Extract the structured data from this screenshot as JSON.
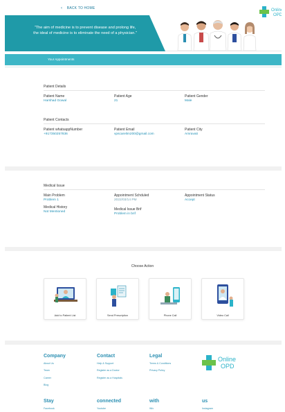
{
  "nav": {
    "back_label": "BACK TO HOME"
  },
  "hero": {
    "quote_line1": "\"The aim of medicine is to prevent disease and prolong life,",
    "quote_line2": "the ideal of medicine is to eliminate the need of a physician.\""
  },
  "brand": {
    "line1": "Online",
    "line2": "OPD",
    "accent": "#2bb3c9",
    "cross_green": "#6cc24a"
  },
  "appointments_bar": {
    "title": "Your Appointments"
  },
  "patient_details": {
    "heading": "Patient Details",
    "name_label": "Patient Name",
    "name_value": "Harshad Gowal",
    "age_label": "Patient Age",
    "age_value": "21",
    "gender_label": "Patient Gender",
    "gender_value": "Male"
  },
  "patient_contacts": {
    "heading": "Patient Contacts",
    "whatsapp_label": "Patient whatsappNumber",
    "whatsapp_value": "+917350257836",
    "email_label": "Patient Email",
    "email_value": "vpscarelim200@gmail.com",
    "city_label": "Patient City",
    "city_value": "Amravati"
  },
  "medical_issue": {
    "heading": "Medical Issue",
    "main_problem_label": "Main Problem",
    "main_problem_value": "Problem 1",
    "schedule_label": "Appointment Schduled",
    "schedule_value": "2022/03/14 PM",
    "status_label": "Appointment Status",
    "status_value": "Accept",
    "history_label": "Medical History",
    "history_value": "Not Mentioned",
    "brief_label": "Medical Issue Brif",
    "brief_value": "Problem in brif"
  },
  "actions": {
    "title": "Choose Action",
    "cards": [
      {
        "label": "Add to Patient List",
        "icon": "video-consult-icon"
      },
      {
        "label": "Send Prescription",
        "icon": "prescription-icon"
      },
      {
        "label": "Phone Call",
        "icon": "phone-call-icon"
      },
      {
        "label": "Video Call",
        "icon": "video-call-icon"
      }
    ]
  },
  "footer": {
    "company": {
      "heading": "Company",
      "links": [
        "About Us",
        "Team",
        "Career",
        "Blog"
      ]
    },
    "contact": {
      "heading": "Contact",
      "links": [
        "Help & Support",
        "Register as a Doctor",
        "Register as a Hospitals"
      ]
    },
    "legal": {
      "heading": "Legal",
      "links": [
        "Terms & Conditions",
        "Privacy Policy"
      ]
    },
    "social_words": [
      "Stay",
      "connected",
      "with",
      "us"
    ],
    "social_links": [
      "Facebook",
      "Youtube",
      "Wix",
      "Instagram"
    ]
  }
}
